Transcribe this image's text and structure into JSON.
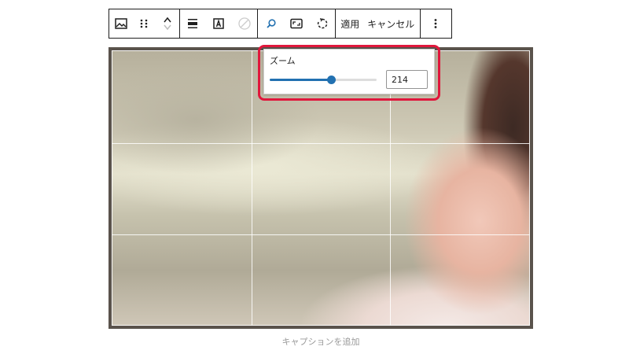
{
  "toolbar": {
    "apply_label": "適用",
    "cancel_label": "キャンセル",
    "icons": [
      "image-icon",
      "drag-handle-icon",
      "move-up-icon",
      "move-down-icon",
      "align-icon",
      "text-overlay-icon",
      "duotone-icon",
      "zoom-icon",
      "aspect-ratio-icon",
      "rotate-icon",
      "more-options-icon"
    ]
  },
  "zoom_popover": {
    "label": "ズーム",
    "value": "214",
    "slider_fraction": 0.57
  },
  "caption": {
    "placeholder": "キャプションを追加"
  },
  "colors": {
    "accent": "#2271b1",
    "highlight": "#e0173c"
  }
}
